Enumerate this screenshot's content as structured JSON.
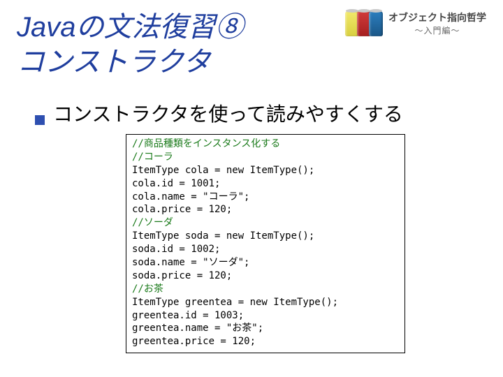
{
  "header": {
    "title": "Javaの文法復習⑧\nコンストラクタ",
    "logo_main": "オブジェクト指向哲学",
    "logo_sub": "～入門編～"
  },
  "bullet": {
    "text": "コンストラクタを使って読みやすくする"
  },
  "code": {
    "c1": "//商品種類をインスタンス化する",
    "c2": "//コーラ",
    "l3": "ItemType cola = new ItemType();",
    "l4": "cola.id = 1001;",
    "l5": "cola.name = \"コーラ\";",
    "l6": "cola.price = 120;",
    "c7": "//ソーダ",
    "l8": "ItemType soda = new ItemType();",
    "l9": "soda.id = 1002;",
    "l10": "soda.name = \"ソーダ\";",
    "l11": "soda.price = 120;",
    "c12": "//お茶",
    "l13": "ItemType greentea = new ItemType();",
    "l14": "greentea.id = 1003;",
    "l15": "greentea.name = \"お茶\";",
    "l16": "greentea.price = 120;"
  }
}
